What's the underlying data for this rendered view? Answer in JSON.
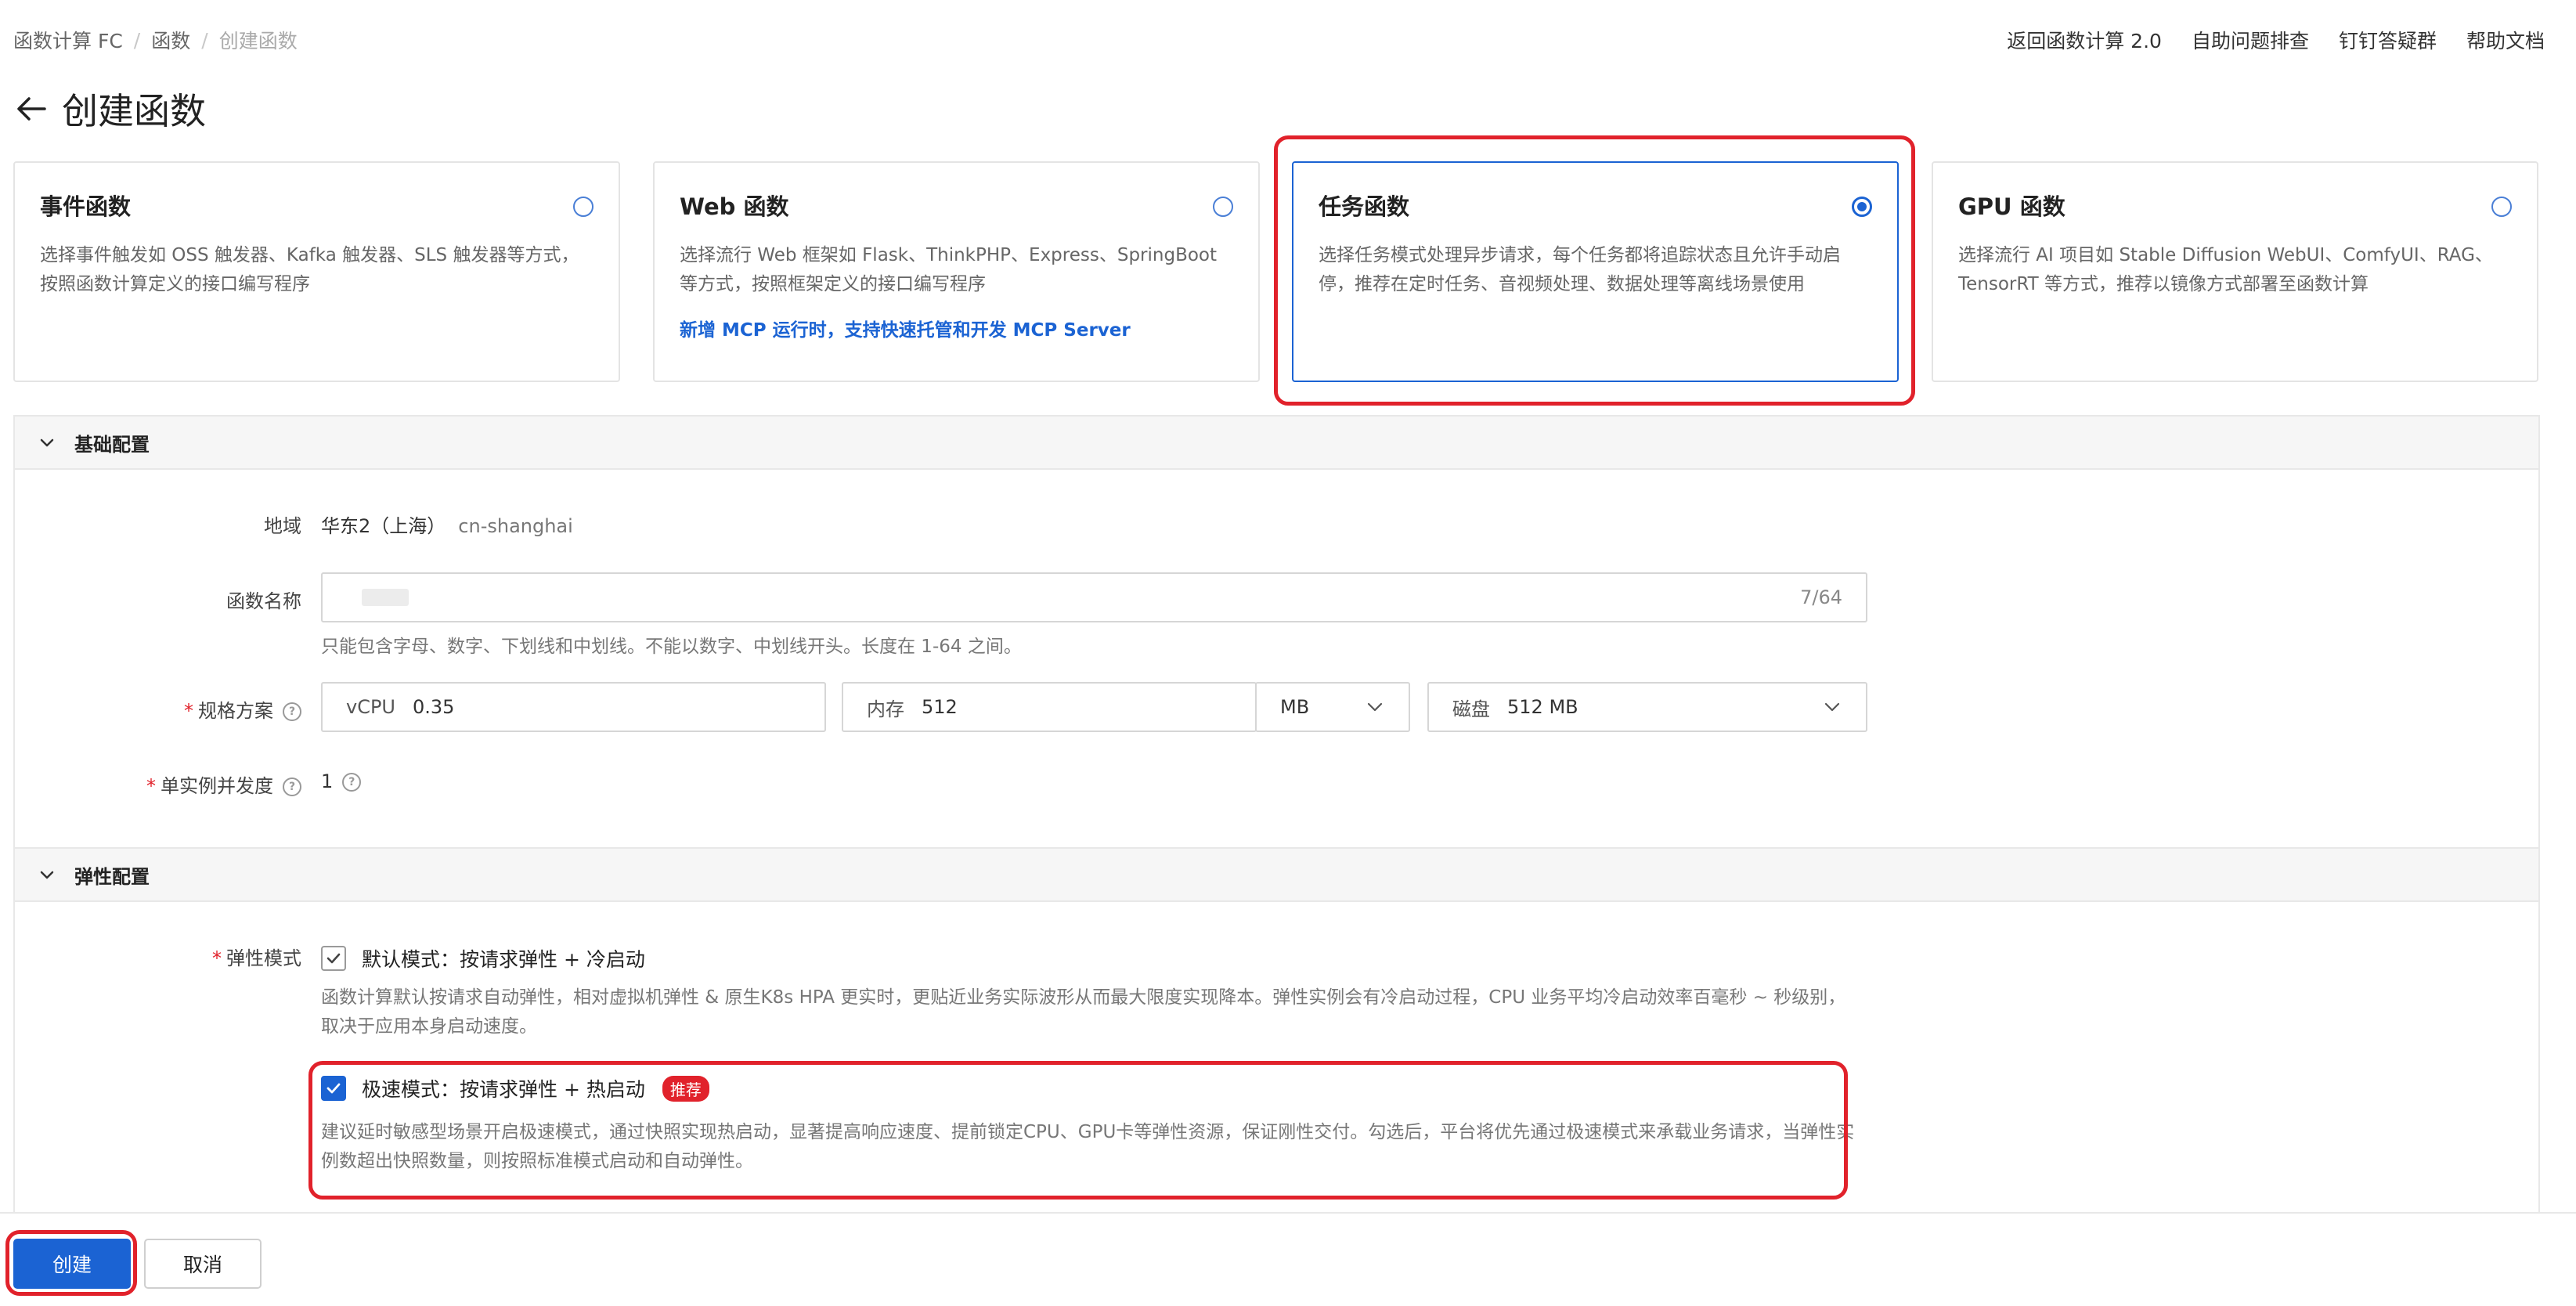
{
  "breadcrumb": {
    "items": [
      "函数计算 FC",
      "函数",
      "创建函数"
    ]
  },
  "top_links": [
    "返回函数计算 2.0",
    "自助问题排查",
    "钉钉答疑群",
    "帮助文档"
  ],
  "page_title": "创建函数",
  "function_types": [
    {
      "title": "事件函数",
      "desc": "选择事件触发如 OSS 触发器、Kafka 触发器、SLS 触发器等方式，按照函数计算定义的接口编写程序",
      "link": "",
      "selected": false
    },
    {
      "title": "Web 函数",
      "desc": "选择流行 Web 框架如 Flask、ThinkPHP、Express、SpringBoot 等方式，按照框架定义的接口编写程序",
      "link": "新增 MCP 运行时，支持快速托管和开发 MCP Server",
      "selected": false
    },
    {
      "title": "任务函数",
      "desc": "选择任务模式处理异步请求，每个任务都将追踪状态且允许手动启停，推荐在定时任务、音视频处理、数据处理等离线场景使用",
      "link": "",
      "selected": true
    },
    {
      "title": "GPU 函数",
      "desc": "选择流行 AI 项目如 Stable Diffusion WebUI、ComfyUI、RAG、TensorRT 等方式，推荐以镜像方式部署至函数计算",
      "link": "",
      "selected": false
    }
  ],
  "basic_config": {
    "section_title": "基础配置",
    "region": {
      "label": "地域",
      "value": "华东2（上海）",
      "code": "cn-shanghai"
    },
    "function_name": {
      "label": "函数名称",
      "counter": "7/64",
      "hint": "只能包含字母、数字、下划线和中划线。不能以数字、中划线开头。长度在 1-64 之间。"
    },
    "spec": {
      "label": "规格方案",
      "vcpu_label": "vCPU",
      "vcpu_value": "0.35",
      "memory_label": "内存",
      "memory_value": "512",
      "memory_unit": "MB",
      "disk_label": "磁盘",
      "disk_value": "512 MB"
    },
    "concurrency": {
      "label": "单实例并发度",
      "value": "1"
    }
  },
  "elastic_config": {
    "section_title": "弹性配置",
    "mode_label": "弹性模式",
    "default_mode": {
      "label": "默认模式：按请求弹性 + 冷启动",
      "checked": true,
      "desc": "函数计算默认按请求自动弹性，相对虚拟机弹性 & 原生K8s HPA 更实时，更贴近业务实际波形从而最大限度实现降本。弹性实例会有冷启动过程，CPU 业务平均冷启动效率百毫秒 ~ 秒级别，取决于应用本身启动速度。"
    },
    "fast_mode": {
      "label": "极速模式：按请求弹性 + 热启动",
      "badge": "推荐",
      "checked": true,
      "desc": "建议延时敏感型场景开启极速模式，通过快照实现热启动，显著提高响应速度、提前锁定CPU、GPU卡等弹性资源，保证刚性交付。勾选后，平台将优先通过极速模式来承载业务请求，当弹性实例数超出快照数量，则按照标准模式启动和自动弹性。"
    }
  },
  "footer": {
    "create_label": "创建",
    "cancel_label": "取消"
  },
  "colors": {
    "accent": "#1b63d3",
    "highlight": "#e1222b"
  }
}
